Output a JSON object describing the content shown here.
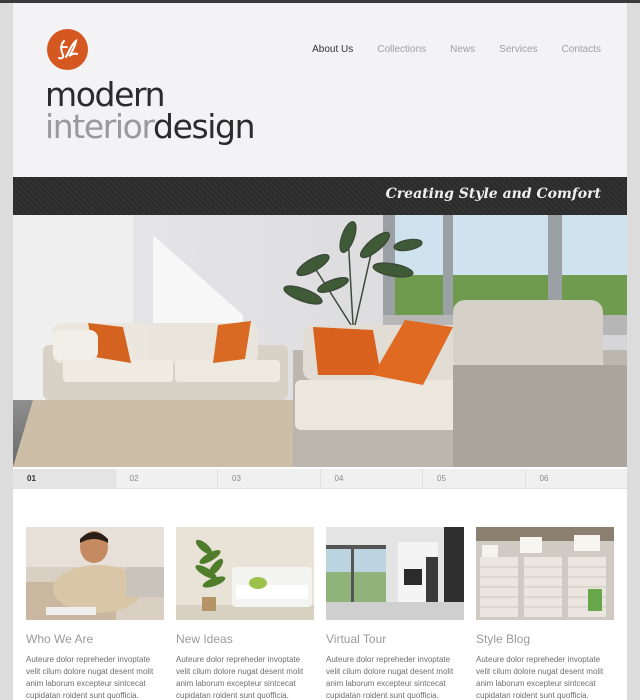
{
  "brand": {
    "logo_line1": "modern",
    "logo_line2_light": "interior",
    "logo_line2_dark": "design",
    "accent_color": "#d4581f"
  },
  "nav": {
    "items": [
      {
        "label": "About Us",
        "active": true
      },
      {
        "label": "Collections",
        "active": false
      },
      {
        "label": "News",
        "active": false
      },
      {
        "label": "Services",
        "active": false
      },
      {
        "label": "Contacts",
        "active": false
      }
    ]
  },
  "banner": {
    "tagline": "Creating Style and Comfort"
  },
  "slider": {
    "items": [
      "01",
      "02",
      "03",
      "04",
      "05",
      "06"
    ],
    "active_index": 0
  },
  "cards": [
    {
      "title": "Who We Are",
      "text": "Auteure dolor repreheder invoptate velit cilum dolore nugat desent molit anim laborum excepteur sintcecat cupidatan roident sunt quofficia.",
      "icon": "man-portrait"
    },
    {
      "title": "New Ideas",
      "text": "Auteure dolor repreheder invoptate velit cilum dolore nugat desent molit anim laborum excepteur sintcecat cupidatan roident sunt quofficia.",
      "icon": "sofa-plant"
    },
    {
      "title": "Virtual Tour",
      "text": "Auteure dolor repreheder invoptate velit cilum dolore nugat desent molit anim laborum excepteur sintcecat cupidatan roident sunt quofficia.",
      "icon": "room-interior"
    },
    {
      "title": "Style Blog",
      "text": "Auteure dolor repreheder invoptate velit cilum dolore nugat desent molit anim laborum excepteur sintcecat cupidatan roident sunt quofficia.",
      "icon": "blinds-lamps"
    }
  ]
}
